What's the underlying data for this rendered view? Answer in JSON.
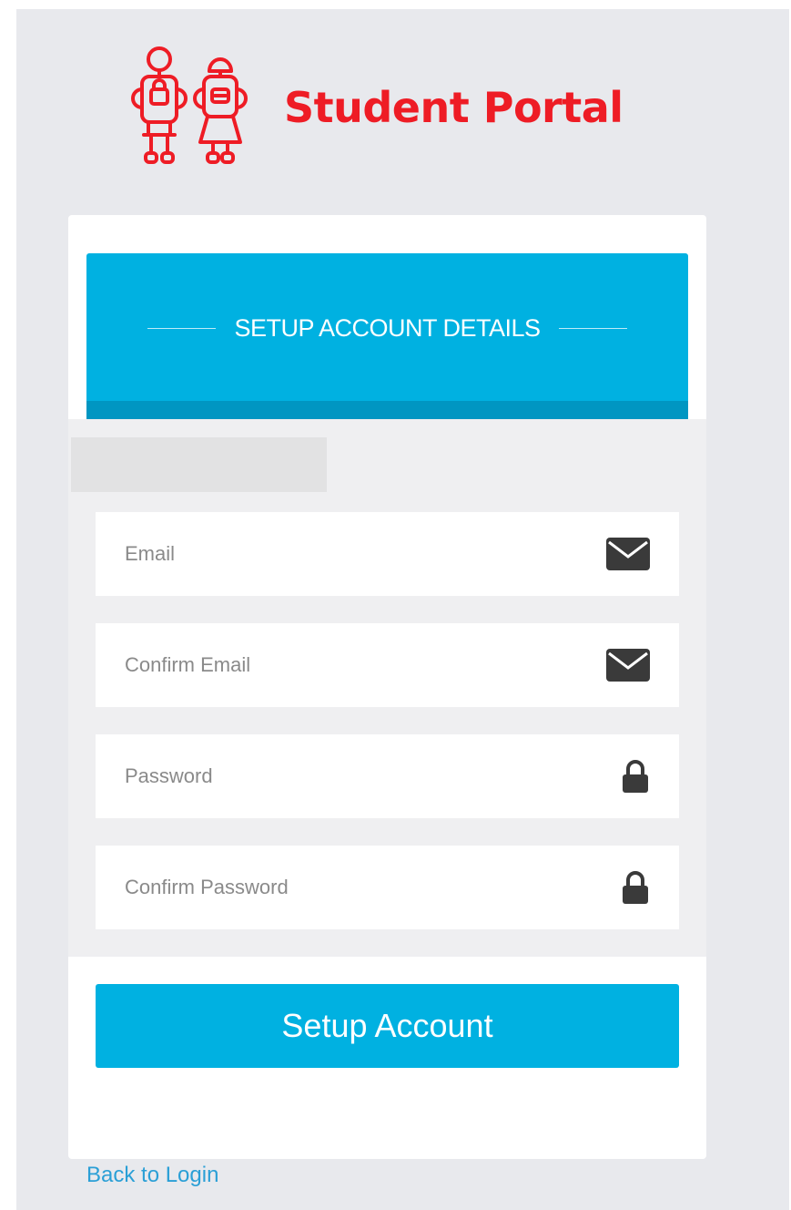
{
  "brand": {
    "name": "Student Portal",
    "color": "#ee1c25",
    "logo_icon": "student-figures-icon"
  },
  "header": {
    "title": "SETUP ACCOUNT DETAILS",
    "accent_color": "#00b1e1"
  },
  "fields": [
    {
      "placeholder": "Email",
      "value": "",
      "icon": "envelope-icon"
    },
    {
      "placeholder": "Confirm Email",
      "value": "",
      "icon": "envelope-icon"
    },
    {
      "placeholder": "Password",
      "value": "",
      "icon": "lock-icon"
    },
    {
      "placeholder": "Confirm Password",
      "value": "",
      "icon": "lock-icon"
    }
  ],
  "actions": {
    "submit_label": "Setup Account",
    "back_link_label": "Back to Login"
  }
}
